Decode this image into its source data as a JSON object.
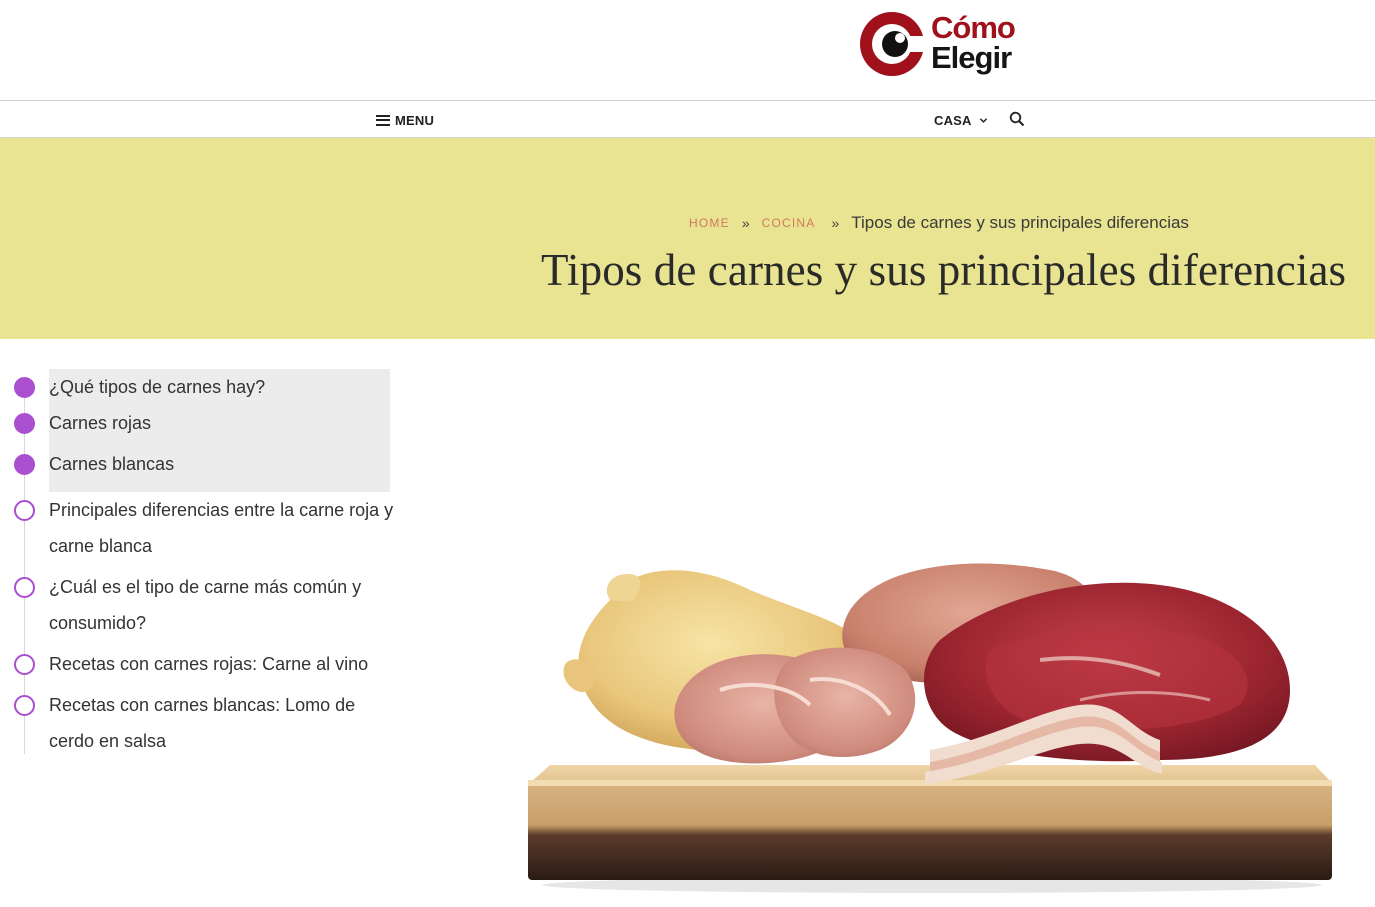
{
  "header": {
    "logo_line1": "Cómo",
    "logo_line2": "Elegir"
  },
  "nav": {
    "menu_label": "MENU",
    "casa_label": "CASA",
    "icons": [
      "hamburger-icon",
      "chevron-down-icon",
      "search-icon"
    ]
  },
  "hero": {
    "breadcrumb": {
      "home": "HOME",
      "separator": "»",
      "category": "COCINA",
      "current": "Tipos de carnes y sus principales diferencias"
    },
    "title": "Tipos de carnes y sus principales diferencias",
    "background_color": "#e8e491"
  },
  "toc": {
    "accent_color": "#a94fcf",
    "items": [
      {
        "label": "¿Qué tipos de carnes hay?",
        "read": true
      },
      {
        "label": "Carnes rojas",
        "read": true
      },
      {
        "label": "Carnes blancas",
        "read": true
      },
      {
        "label": "Principales diferencias entre la carne roja y carne blanca",
        "read": false
      },
      {
        "label": "¿Cuál es el tipo de carne más común y consumido?",
        "read": false
      },
      {
        "label": "Recetas con carnes rojas: Carne al vino",
        "read": false
      },
      {
        "label": "Recetas con carnes blancas: Lomo de cerdo en salsa",
        "read": false
      }
    ]
  },
  "colors": {
    "brand_red": "#a0111b",
    "link_color": "#d07a62"
  }
}
